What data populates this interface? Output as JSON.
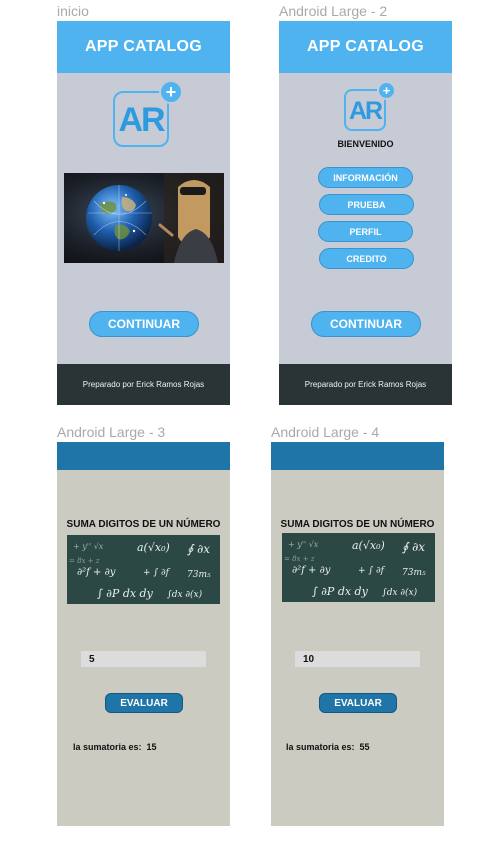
{
  "frames": {
    "inicio": {
      "label": "inicio",
      "header_title": "APP CATALOG",
      "logo_text": "AR",
      "logo_plus": "+",
      "continue_label": "CONTINUAR",
      "footer_text": "Preparado por Erick Ramos Rojas"
    },
    "android_large_2": {
      "label": "Android Large - 2",
      "header_title": "APP CATALOG",
      "logo_text": "AR",
      "logo_plus": "+",
      "welcome": "BIENVENIDO",
      "menu": [
        {
          "label": "INFORMACIÓN"
        },
        {
          "label": "PRUEBA"
        },
        {
          "label": "PERFIL"
        },
        {
          "label": "CREDITO"
        }
      ],
      "continue_label": "CONTINUAR",
      "footer_text": "Preparado por Erick Ramos Rojas"
    },
    "android_large_3": {
      "label": "Android Large - 3",
      "title": "SUMA DIGITOS DE UN NÚMERO",
      "input_value": "5",
      "button_label": "EVALUAR",
      "result_label": "la sumatoria es:",
      "result_value": "15"
    },
    "android_large_4": {
      "label": "Android Large - 4",
      "title": "SUMA DIGITOS DE UN NÚMERO",
      "input_value": "10",
      "button_label": "EVALUAR",
      "result_label": "la sumatoria es:",
      "result_value": "55"
    }
  },
  "colors": {
    "header_blue": "#4fb3ef",
    "frame_gray": "#c7cbd5",
    "footer_dark": "#2a3336",
    "dark_header_blue": "#1f75a8",
    "beige": "#cccbc1"
  }
}
